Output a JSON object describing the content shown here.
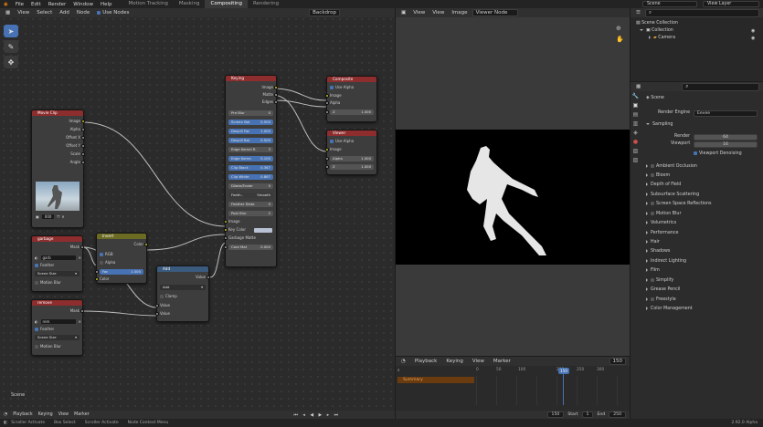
{
  "menu": {
    "items": [
      "File",
      "Edit",
      "Render",
      "Window",
      "Help"
    ]
  },
  "workspaces": {
    "items": [
      "Motion Tracking",
      "Masking",
      "Compositing",
      "Rendering"
    ],
    "active": "Compositing"
  },
  "top_right": {
    "scene": "Scene",
    "view_layer": "View Layer"
  },
  "node_header": {
    "items": [
      "View",
      "Select",
      "Add",
      "Node"
    ],
    "use_nodes": "Use Nodes",
    "backdrop": "Backdrop"
  },
  "nodes": {
    "movie_clip": {
      "title": "Movie Clip",
      "outputs": [
        "Image",
        "Alpha",
        "Offset X",
        "Offset Y",
        "Scale",
        "Angle"
      ],
      "frame": "000"
    },
    "keying": {
      "title": "Keying",
      "outputs": [
        "Image",
        "Matte",
        "Edges"
      ],
      "fields": [
        {
          "label": "Pre Blur",
          "value": "0"
        },
        {
          "label": "Screen Bal.",
          "value": "0.500"
        },
        {
          "label": "Despill Fac",
          "value": "1.000"
        },
        {
          "label": "Despill Bal",
          "value": "0.500"
        },
        {
          "label": "Edge Kernel R.",
          "value": "3"
        },
        {
          "label": "Edge Kerne.",
          "value": "0.100"
        },
        {
          "label": "Clip Black",
          "value": "0.367"
        },
        {
          "label": "Clip White",
          "value": "0.867"
        },
        {
          "label": "Dilate/Erode",
          "value": "0"
        },
        {
          "label": "Feath..",
          "value": "Smooth"
        },
        {
          "label": "Feather Dista",
          "value": "0"
        },
        {
          "label": "Post Blur",
          "value": "2"
        }
      ],
      "inputs": [
        "Image",
        "Key Color",
        "Garbage Matte",
        "Core Mat"
      ],
      "core_matte": "0.000"
    },
    "composite": {
      "title": "Composite",
      "use_alpha": "Use Alpha",
      "inputs": [
        "Image",
        "Alpha"
      ],
      "z_label": "Z",
      "z_value": "1.000"
    },
    "viewer": {
      "title": "Viewer",
      "use_alpha": "Use Alpha",
      "inputs": [
        "Image"
      ],
      "alpha_label": "Alpha",
      "alpha_value": "1.000",
      "z_label": "Z",
      "z_value": "1.000"
    },
    "garbage": {
      "title": "garbage",
      "output": "Mask",
      "mask_name": "garb",
      "feather": "Feather",
      "size": "Scene Size",
      "motion_blur": "Motion Blur"
    },
    "invert": {
      "title": "Invert",
      "output": "Color",
      "rgb": "RGB",
      "alpha": "Alpha",
      "fac_label": "Fac",
      "fac_value": "1.000",
      "input": "Color"
    },
    "add": {
      "title": "Add",
      "output": "Value",
      "op": "Add",
      "clamp": "Clamp",
      "inputs": [
        "Value",
        "Value"
      ]
    },
    "remove": {
      "title": "remove",
      "output": "Mask",
      "mask_name": "rem",
      "feather": "Feather",
      "size": "Scene Size",
      "motion_blur": "Motion Blur"
    }
  },
  "node_editor_footer": "Scene",
  "viewer_header": {
    "items": [
      "View",
      "View",
      "Image"
    ],
    "node": "Viewer Node"
  },
  "timeline": {
    "items": [
      "Playback",
      "Keying",
      "View",
      "Marker"
    ],
    "current_frame": "150",
    "summary": "Summary",
    "ticks": [
      "0",
      "50",
      "100",
      "150",
      "200",
      "250",
      "300"
    ],
    "start_label": "Start",
    "start": "1",
    "end_label": "End",
    "end": "250"
  },
  "outliner": {
    "root": "Scene Collection",
    "collection": "Collection",
    "camera": "Camera"
  },
  "properties": {
    "scene": "Scene",
    "render_engine_label": "Render Engine",
    "render_engine": "Eevee",
    "sampling": "Sampling",
    "render_label": "Render",
    "render_value": "64",
    "viewport_label": "Viewport",
    "viewport_value": "16",
    "viewport_denoising": "Viewport Denoising",
    "panels": [
      "Ambient Occlusion",
      "Bloom",
      "Depth of Field",
      "Subsurface Scattering",
      "Screen Space Reflections",
      "Motion Blur",
      "Volumetrics",
      "Performance",
      "Hair",
      "Shadows",
      "Indirect Lighting",
      "Film",
      "Simplify",
      "Grease Pencil",
      "Freestyle",
      "Color Management"
    ]
  },
  "status_bar": {
    "items": [
      "Scroller Activate",
      "Box Select",
      "Scroller Activate",
      "Node Context Menu"
    ],
    "version": "2.92.0 Alpha"
  },
  "colors": {
    "accent": "#4772b3",
    "composite_header": "#8e2d2d",
    "mask_header": "#8e2d2d",
    "converter_header": "#3a5b7e",
    "color_header": "#6b6b24",
    "timeline_cursor": "#4772b3"
  }
}
